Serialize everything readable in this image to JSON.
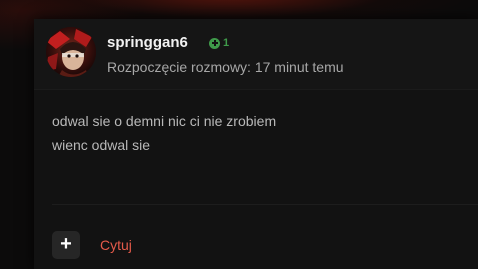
{
  "post": {
    "author": "springgan6",
    "reputation": "1",
    "meta": "Rozpoczęcie rozmowy: 17 minut temu",
    "body_lines": [
      "odwal sie o demni nic ci nie zrobiem",
      "wienc odwal sie"
    ],
    "actions": {
      "plus_label": "+",
      "quote_label": "Cytuj"
    }
  },
  "icons": {
    "reputation": "plus-circle-icon",
    "avatar": "user-avatar-image"
  },
  "colors": {
    "reputation": "#3f9a4a",
    "quote_link": "#e45a4a",
    "card_background": "#121212"
  }
}
